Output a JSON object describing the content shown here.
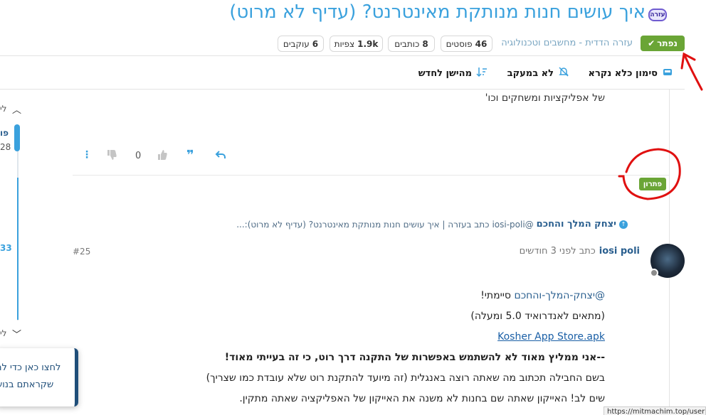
{
  "topic": {
    "title": "איך עושים חנות מנותקת מאינטרנט? (עדיף לא מרוט)",
    "category_badge": "עזרה",
    "solved_label": "נפתר",
    "category_path": "עזרה הדדית - מחשבים וטכנולוגיה"
  },
  "stats": {
    "posts": {
      "value": "46",
      "label": "פוסטים"
    },
    "posters": {
      "value": "8",
      "label": "כותבים"
    },
    "views": {
      "value": "1.9k",
      "label": "צפיות"
    },
    "followers": {
      "value": "6",
      "label": "עוקבים"
    }
  },
  "toolbar": {
    "mark_read": "סימון כלא נקרא",
    "not_tracking": "לא במעקב",
    "sort": "מהישן לחדש"
  },
  "timeline": {
    "edge_top": "לי",
    "edge_mid_a": "פו",
    "edge_mid_b": "28",
    "edge_mid_c": "33",
    "edge_bottom": "לי"
  },
  "prev_post": {
    "tail_text": "של אפליקציות ומשחקים וכו'",
    "votes": "0",
    "solution_label": "פתרון"
  },
  "backlink": {
    "user": "יצחק המלך והחכם",
    "mention": "@iosi-poli",
    "text": "כתב בעזרה | איך עושים חנות מנותקת מאינטרנט? (עדיף לא מרוט):..."
  },
  "post": {
    "author": "iosi poli",
    "meta": "כתב לפני 3 חודשים",
    "index": "#25",
    "mention": "@יצחק-המלך-והחכם",
    "line1_rest": " סיימתי!",
    "line2": "(מתאים לאנדרואיד 5.0 ומעלה)",
    "link": "Kosher App Store.apk",
    "line4": "--אני ממליץ מאוד לא להשתמש באפשרות של התקנה דרך רוט, כי זה בעייתי מאוד!",
    "line5": "בשם החבילה תכתוב מה שאתה רוצה באנגלית (זה מיועד להתקנת רוט שלא עובדת כמו שצריך)",
    "line6": "שים לב! האייקון שאתה שם בחנות לא משנה את האייקון של האפליקציה שאתה מתקין."
  },
  "toast": {
    "line1": "לחצו כאן כדי לה",
    "line2": "שקראתם בנוש"
  },
  "url_tooltip": "https://mitmachim.top/user",
  "colors": {
    "title": "#3aa1dd",
    "solved": "#6aa536",
    "link": "#2a5f8f",
    "annotation": "#e01010"
  }
}
